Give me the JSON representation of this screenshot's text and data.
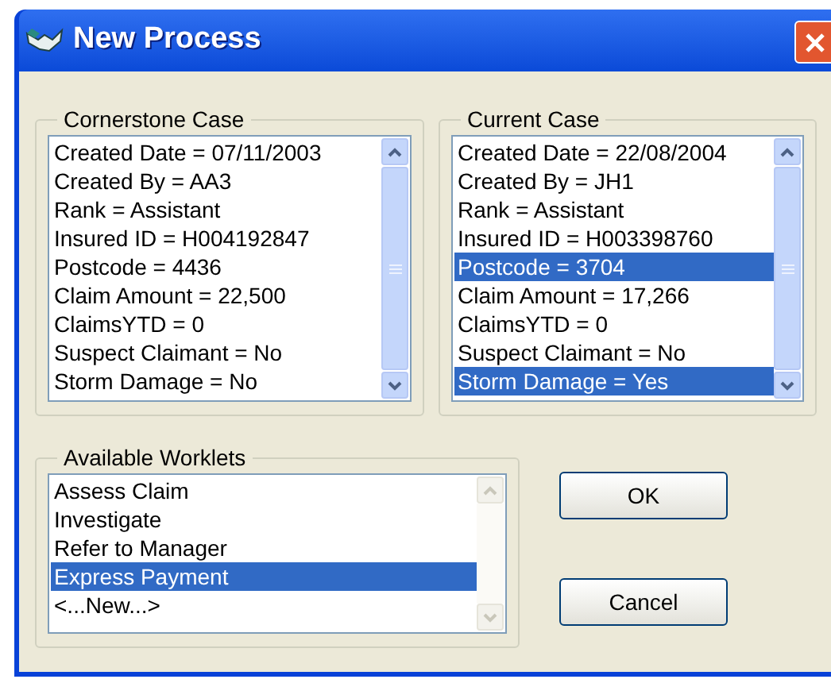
{
  "window": {
    "title": "New Process"
  },
  "cornerstone_case": {
    "label": "Cornerstone Case",
    "items": [
      {
        "text": "Created Date = 07/11/2003",
        "selected": false
      },
      {
        "text": "Created By = AA3",
        "selected": false
      },
      {
        "text": "Rank = Assistant",
        "selected": false
      },
      {
        "text": "Insured ID = H004192847",
        "selected": false
      },
      {
        "text": "Postcode = 4436",
        "selected": false
      },
      {
        "text": "Claim Amount = 22,500",
        "selected": false
      },
      {
        "text": "ClaimsYTD = 0",
        "selected": false
      },
      {
        "text": "Suspect Claimant = No",
        "selected": false
      },
      {
        "text": "Storm Damage = No",
        "selected": false
      }
    ]
  },
  "current_case": {
    "label": "Current Case",
    "items": [
      {
        "text": "Created Date = 22/08/2004",
        "selected": false
      },
      {
        "text": "Created By = JH1",
        "selected": false
      },
      {
        "text": "Rank = Assistant",
        "selected": false
      },
      {
        "text": "Insured ID = H003398760",
        "selected": false
      },
      {
        "text": "Postcode = 3704",
        "selected": true
      },
      {
        "text": "Claim Amount = 17,266",
        "selected": false
      },
      {
        "text": "ClaimsYTD = 0",
        "selected": false
      },
      {
        "text": "Suspect Claimant = No",
        "selected": false
      },
      {
        "text": "Storm Damage = Yes",
        "selected": true
      }
    ]
  },
  "available_worklets": {
    "label": "Available Worklets",
    "items": [
      {
        "text": "Assess Claim",
        "selected": false
      },
      {
        "text": "Investigate",
        "selected": false
      },
      {
        "text": "Refer to Manager",
        "selected": false
      },
      {
        "text": "Express Payment",
        "selected": true
      },
      {
        "text": "<...New...>",
        "selected": false
      }
    ]
  },
  "buttons": [
    "OK",
    "Cancel"
  ]
}
